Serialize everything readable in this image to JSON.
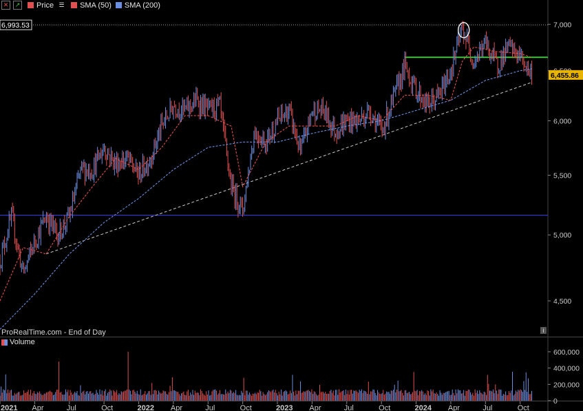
{
  "legend": {
    "items": [
      {
        "label": "Price",
        "color": "#e05050"
      },
      {
        "label": "SMA (50)",
        "color": "#e05050"
      },
      {
        "label": "SMA (200)",
        "color": "#6b8fe0"
      }
    ]
  },
  "source_label": "ProRealTime.com - End of Day",
  "volume_label": "Volume",
  "price_badges": {
    "high_label": "6,993.53",
    "last_label": "6,455.86"
  },
  "chart_data": {
    "type": "candlestick",
    "x_tick_labels": [
      "2021",
      "Apr",
      "Jul",
      "Oct",
      "2022",
      "Apr",
      "Jul",
      "Oct",
      "2023",
      "Apr",
      "Jul",
      "Oct",
      "2024",
      "Apr",
      "Jul",
      "Oct"
    ],
    "y_tick_labels": [
      "7,000",
      "6,500",
      "6,000",
      "5,500",
      "5,000",
      "4,500"
    ],
    "ylim": [
      4250,
      7150
    ],
    "log_scale": true,
    "price_path": [
      [
        "2021-01",
        4800
      ],
      [
        "2021-02",
        5150
      ],
      [
        "2021-03",
        4700
      ],
      [
        "2021-04",
        4950
      ],
      [
        "2021-05",
        5150
      ],
      [
        "2021-06",
        5000
      ],
      [
        "2021-07",
        5150
      ],
      [
        "2021-08",
        5550
      ],
      [
        "2021-09",
        5550
      ],
      [
        "2021-10",
        5750
      ],
      [
        "2021-11",
        5600
      ],
      [
        "2021-12",
        5650
      ],
      [
        "2022-01",
        5500
      ],
      [
        "2022-02",
        5650
      ],
      [
        "2022-03",
        5950
      ],
      [
        "2022-04",
        6150
      ],
      [
        "2022-05",
        6100
      ],
      [
        "2022-06",
        6200
      ],
      [
        "2022-07",
        6100
      ],
      [
        "2022-08",
        6150
      ],
      [
        "2022-09",
        5400
      ],
      [
        "2022-10",
        5200
      ],
      [
        "2022-11",
        5900
      ],
      [
        "2022-12",
        5800
      ],
      [
        "2023-01",
        6000
      ],
      [
        "2023-02",
        6100
      ],
      [
        "2023-03",
        5700
      ],
      [
        "2023-04",
        6100
      ],
      [
        "2023-05",
        6100
      ],
      [
        "2023-06",
        5900
      ],
      [
        "2023-07",
        6000
      ],
      [
        "2023-08",
        6000
      ],
      [
        "2023-09",
        6100
      ],
      [
        "2023-10",
        5900
      ],
      [
        "2023-11",
        6200
      ],
      [
        "2023-12",
        6550
      ],
      [
        "2024-01",
        6300
      ],
      [
        "2024-02",
        6150
      ],
      [
        "2024-03",
        6250
      ],
      [
        "2024-04",
        6500
      ],
      [
        "2024-05",
        6950
      ],
      [
        "2024-06",
        6600
      ],
      [
        "2024-07",
        6800
      ],
      [
        "2024-08",
        6550
      ],
      [
        "2024-09",
        6750
      ],
      [
        "2024-10",
        6650
      ],
      [
        "2024-11",
        6456
      ]
    ],
    "sma50": [
      [
        "2021-01",
        4500
      ],
      [
        "2021-03",
        4900
      ],
      [
        "2021-05",
        4850
      ],
      [
        "2021-07",
        5150
      ],
      [
        "2021-09",
        5400
      ],
      [
        "2021-11",
        5650
      ],
      [
        "2022-01",
        5550
      ],
      [
        "2022-03",
        5750
      ],
      [
        "2022-05",
        6050
      ],
      [
        "2022-07",
        6050
      ],
      [
        "2022-09",
        5950
      ],
      [
        "2022-10",
        5400
      ],
      [
        "2022-12",
        5800
      ],
      [
        "2023-02",
        5950
      ],
      [
        "2023-04",
        5950
      ],
      [
        "2023-06",
        5950
      ],
      [
        "2023-08",
        6050
      ],
      [
        "2023-10",
        6000
      ],
      [
        "2023-12",
        6250
      ],
      [
        "2024-02",
        6250
      ],
      [
        "2024-04",
        6200
      ],
      [
        "2024-05",
        6600
      ],
      [
        "2024-06",
        6750
      ],
      [
        "2024-08",
        6700
      ],
      [
        "2024-10",
        6680
      ],
      [
        "2024-11",
        6640
      ]
    ],
    "sma200": [
      [
        "2021-01",
        4300
      ],
      [
        "2021-04",
        4550
      ],
      [
        "2021-07",
        4850
      ],
      [
        "2021-10",
        5100
      ],
      [
        "2022-01",
        5300
      ],
      [
        "2022-04",
        5550
      ],
      [
        "2022-07",
        5750
      ],
      [
        "2022-10",
        5800
      ],
      [
        "2023-01",
        5800
      ],
      [
        "2023-04",
        5880
      ],
      [
        "2023-07",
        5950
      ],
      [
        "2023-10",
        6000
      ],
      [
        "2024-01",
        6100
      ],
      [
        "2024-04",
        6200
      ],
      [
        "2024-07",
        6400
      ],
      [
        "2024-10",
        6500
      ],
      [
        "2024-11",
        6520
      ]
    ],
    "trendline": [
      [
        "2021-05",
        4850
      ],
      [
        "2024-11",
        6380
      ]
    ],
    "support_level": 5160,
    "resistance_level": 6640,
    "resistance_start": "2023-12",
    "high_marker": [
      "2024-05",
      6950
    ],
    "high_value": 6993.53,
    "last_value": 6455.86,
    "volume": {
      "y_tick_labels": [
        "600,000",
        "400,000",
        "200,000",
        "0"
      ],
      "ylim": [
        0,
        650000
      ]
    }
  }
}
